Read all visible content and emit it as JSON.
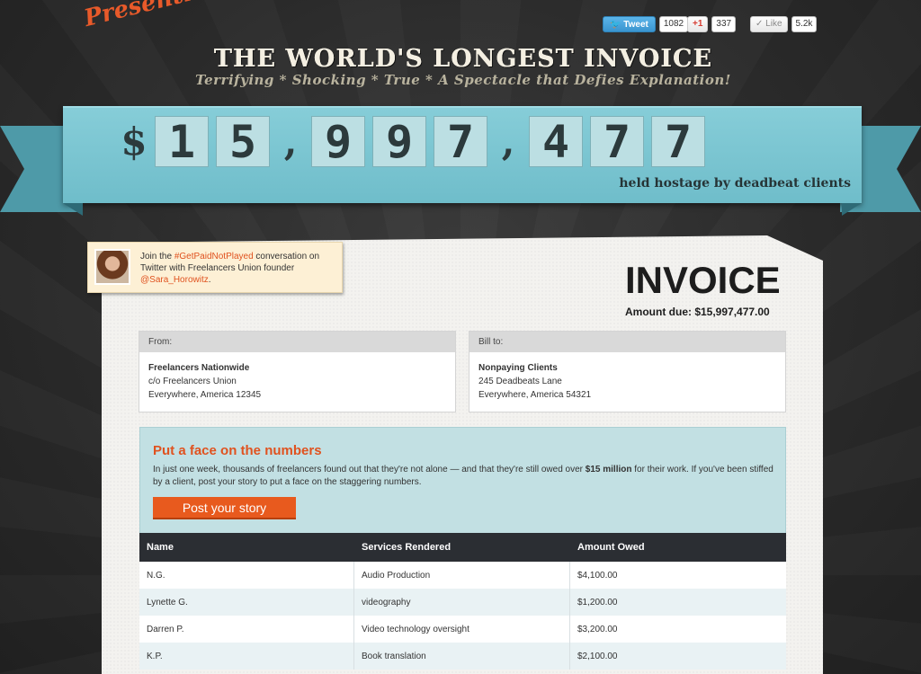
{
  "header": {
    "presenting": "Presenting",
    "title": "THE WORLD'S LONGEST INVOICE",
    "tagline": "Terrifying * Shocking * True * A Spectacle that Defies Explanation!"
  },
  "social": {
    "tweet_label": "Tweet",
    "tweet_count": "1082",
    "gplus_label": "+1",
    "gplus_count": "337",
    "like_label": "Like",
    "like_count": "5.2k"
  },
  "ribbon": {
    "digits": [
      "$",
      "1",
      "5",
      ",",
      "9",
      "9",
      "7",
      ",",
      "4",
      "7",
      "7"
    ],
    "caption": "held hostage by deadbeat clients"
  },
  "callout": {
    "text_before": "Join the ",
    "hashtag": "#GetPaidNotPlayed",
    "text_mid": " conversation on Twitter with Freelancers Union founder ",
    "handle": "@Sara_Horowitz",
    "text_after": "."
  },
  "invoice": {
    "title": "INVOICE",
    "amount_due": "Amount due: $15,997,477.00"
  },
  "from": {
    "label": "From:",
    "name": "Freelancers Nationwide",
    "line1": "c/o Freelancers Union",
    "line2": "Everywhere, America 12345"
  },
  "bill_to": {
    "label": "Bill to:",
    "name": "Nonpaying Clients",
    "line1": "245 Deadbeats Lane",
    "line2": "Everywhere, America 54321"
  },
  "face": {
    "heading": "Put a face on the numbers",
    "text_before": "In just one week, thousands of freelancers found out that they're not alone — and that they're still owed over ",
    "text_bold": "$15 million",
    "text_after": " for their work. If you've been stiffed by a client, post your story to put a face on the staggering numbers.",
    "button": "Post your story"
  },
  "table": {
    "headers": [
      "Name",
      "Services Rendered",
      "Amount Owed"
    ],
    "rows": [
      [
        "N.G.",
        "Audio Production",
        "$4,100.00"
      ],
      [
        "Lynette G.",
        "videography",
        "$1,200.00"
      ],
      [
        "Darren P.",
        "Video technology oversight",
        "$3,200.00"
      ],
      [
        "K.P.",
        "Book translation",
        "$2,100.00"
      ]
    ]
  },
  "colors": {
    "accent": "#e0521f",
    "ribbon": "#7cc6d2",
    "table_header": "#2b2e33"
  }
}
